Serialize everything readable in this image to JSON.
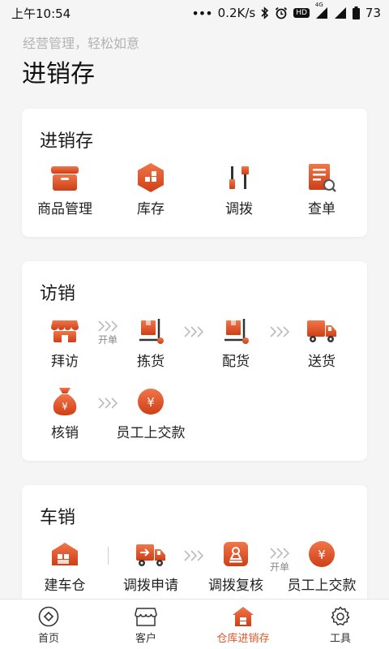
{
  "status_bar": {
    "time": "上午10:54",
    "network_speed": "0.2K/s",
    "network_type": "4G",
    "hd_badge": "HD",
    "battery": "73"
  },
  "header": {
    "subtitle": "经营管理，轻松如意",
    "title": "进销存"
  },
  "colors": {
    "accent": "#e0562a",
    "accent_dark": "#c9441a",
    "background": "#f5f5f5"
  },
  "section_inventory": {
    "title": "进销存",
    "items": [
      {
        "label": "商品管理",
        "icon": "box-icon"
      },
      {
        "label": "库存",
        "icon": "inventory-icon"
      },
      {
        "label": "调拨",
        "icon": "transfer-icon"
      },
      {
        "label": "查单",
        "icon": "order-search-icon"
      }
    ]
  },
  "section_visit": {
    "title": "访销",
    "items": [
      {
        "label": "拜访",
        "icon": "store-icon"
      },
      {
        "label": "拣货",
        "icon": "pick-goods-icon"
      },
      {
        "label": "配货",
        "icon": "distribute-goods-icon"
      },
      {
        "label": "送货",
        "icon": "delivery-truck-icon"
      },
      {
        "label": "核销",
        "icon": "money-bag-icon"
      },
      {
        "label": "员工上交款",
        "icon": "yuan-coin-icon"
      }
    ],
    "arrow_note": "开单"
  },
  "section_car": {
    "title": "车销",
    "items": [
      {
        "label": "建车仓",
        "icon": "warehouse-icon"
      },
      {
        "label": "调拨申请",
        "icon": "transfer-truck-icon"
      },
      {
        "label": "调拨复核",
        "icon": "review-stamp-icon"
      },
      {
        "label": "员工上交款",
        "icon": "yuan-coin-icon"
      }
    ],
    "arrow_note": "开单"
  },
  "bottom_nav": {
    "items": [
      {
        "label": "首页",
        "icon": "home-diamond-icon"
      },
      {
        "label": "客户",
        "icon": "customer-store-icon"
      },
      {
        "label": "仓库进销存",
        "icon": "warehouse-home-icon",
        "active": true
      },
      {
        "label": "工具",
        "icon": "gear-icon"
      }
    ]
  }
}
